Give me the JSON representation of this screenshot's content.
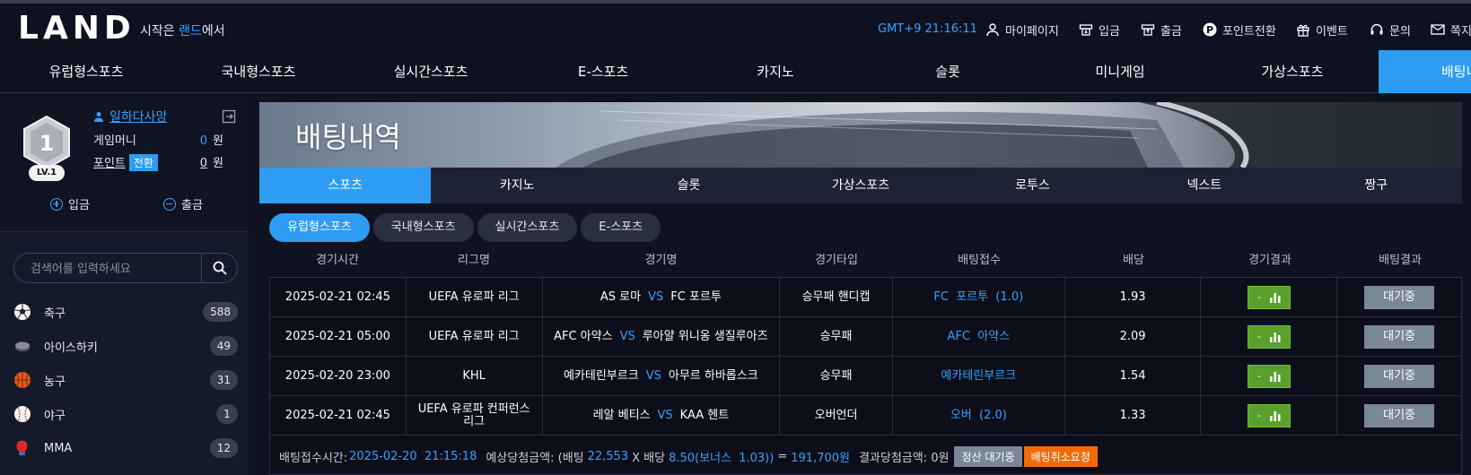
{
  "header": {
    "logo": "LAND",
    "tagline_prefix": "시작은 ",
    "tagline_brand": "랜드",
    "tagline_suffix": "에서",
    "clock": "GMT+9 21:16:11",
    "menu": [
      {
        "label": "마이페이지",
        "icon": "person-icon"
      },
      {
        "label": "입금",
        "icon": "deposit-icon"
      },
      {
        "label": "출금",
        "icon": "withdraw-icon"
      },
      {
        "label": "포인트전환",
        "icon": "point-icon"
      },
      {
        "label": "이벤트",
        "icon": "gift-icon"
      },
      {
        "label": "문의",
        "icon": "headset-icon"
      },
      {
        "label": "쪽지",
        "icon": "mail-icon"
      }
    ]
  },
  "nav": {
    "items": [
      "유럽형스포츠",
      "국내형스포츠",
      "실시간스포츠",
      "E-스포츠",
      "카지노",
      "슬롯",
      "미니게임",
      "가상스포츠",
      "배팅내역"
    ],
    "active_index": 8
  },
  "user": {
    "level_number": "1",
    "level_label": "LV.1",
    "name": "일하다사망",
    "money_label": "게임머니",
    "money_value": "0",
    "money_unit": "원",
    "point_label": "포인트",
    "convert_label": "전환",
    "point_value": "0",
    "point_unit": "원",
    "deposit_label": "입금",
    "withdraw_label": "출금"
  },
  "search": {
    "placeholder": "검색어를 입력하세요"
  },
  "sports": [
    {
      "name": "축구",
      "count": "588",
      "icon": "soccer-ball-icon"
    },
    {
      "name": "아이스하키",
      "count": "49",
      "icon": "hockey-puck-icon"
    },
    {
      "name": "농구",
      "count": "31",
      "icon": "basketball-icon"
    },
    {
      "name": "야구",
      "count": "1",
      "icon": "baseball-icon"
    },
    {
      "name": "MMA",
      "count": "12",
      "icon": "boxing-glove-icon"
    }
  ],
  "page": {
    "title": "배팅내역",
    "tabs": [
      "스포츠",
      "카지노",
      "슬롯",
      "가상스포츠",
      "로투스",
      "넥스트",
      "짱구"
    ],
    "active_tab": 0,
    "pills": [
      "유럽형스포츠",
      "국내형스포츠",
      "실시간스포츠",
      "E-스포츠"
    ],
    "active_pill": 0
  },
  "table": {
    "headers": [
      "경기시간",
      "리그명",
      "경기명",
      "경기타입",
      "배팅접수",
      "배당",
      "경기결과",
      "배팅결과"
    ],
    "vs": "VS",
    "rows": [
      {
        "time": "2025-02-21 02:45",
        "league": "UEFA 유로파 리그",
        "home": "AS 로마",
        "away": "FC 포르투",
        "type": "승무패 핸디캡",
        "pick": "FC  포르투  (1.0)",
        "odds": "1.93",
        "result": "-",
        "status": "대기중"
      },
      {
        "time": "2025-02-21 05:00",
        "league": "UEFA 유로파 리그",
        "home": "AFC 아약스",
        "away": "루아얄 위니옹 생질루아즈",
        "type": "승무패",
        "pick": "AFC  아약스",
        "odds": "2.09",
        "result": "-",
        "status": "대기중"
      },
      {
        "time": "2025-02-20 23:00",
        "league": "KHL",
        "home": "예카테린부르크",
        "away": "아무르 하바롭스크",
        "type": "승무패",
        "pick": "예카테린부르크",
        "odds": "1.54",
        "result": "-",
        "status": "대기중"
      },
      {
        "time": "2025-02-21 02:45",
        "league": "UEFA 유로파 컨퍼런스 리그",
        "home": "레알 베티스",
        "away": "KAA 헨트",
        "type": "오버언더",
        "pick": "오버  (2.0)",
        "odds": "1.33",
        "result": "-",
        "status": "대기중"
      }
    ]
  },
  "summary": {
    "time_label": "배팅접수시간:",
    "time_value": "2025-02-20  21:15:18",
    "expected_label": "예상당첨금액: (배팅",
    "bet_amount": "22,553",
    "x_label": "X 배당",
    "odds_text": "8.50(보너스  1.03))",
    "equals": "=",
    "expected_value": "191,700원",
    "result_label": "결과당첨금액: 0원",
    "pending_button": "정산 대기중",
    "cancel_button": "배팅취소요청"
  },
  "colors": {
    "accent": "#2e9cf2",
    "link": "#3aa0ff",
    "green": "#5aa02c",
    "orange": "#f26a0a"
  }
}
